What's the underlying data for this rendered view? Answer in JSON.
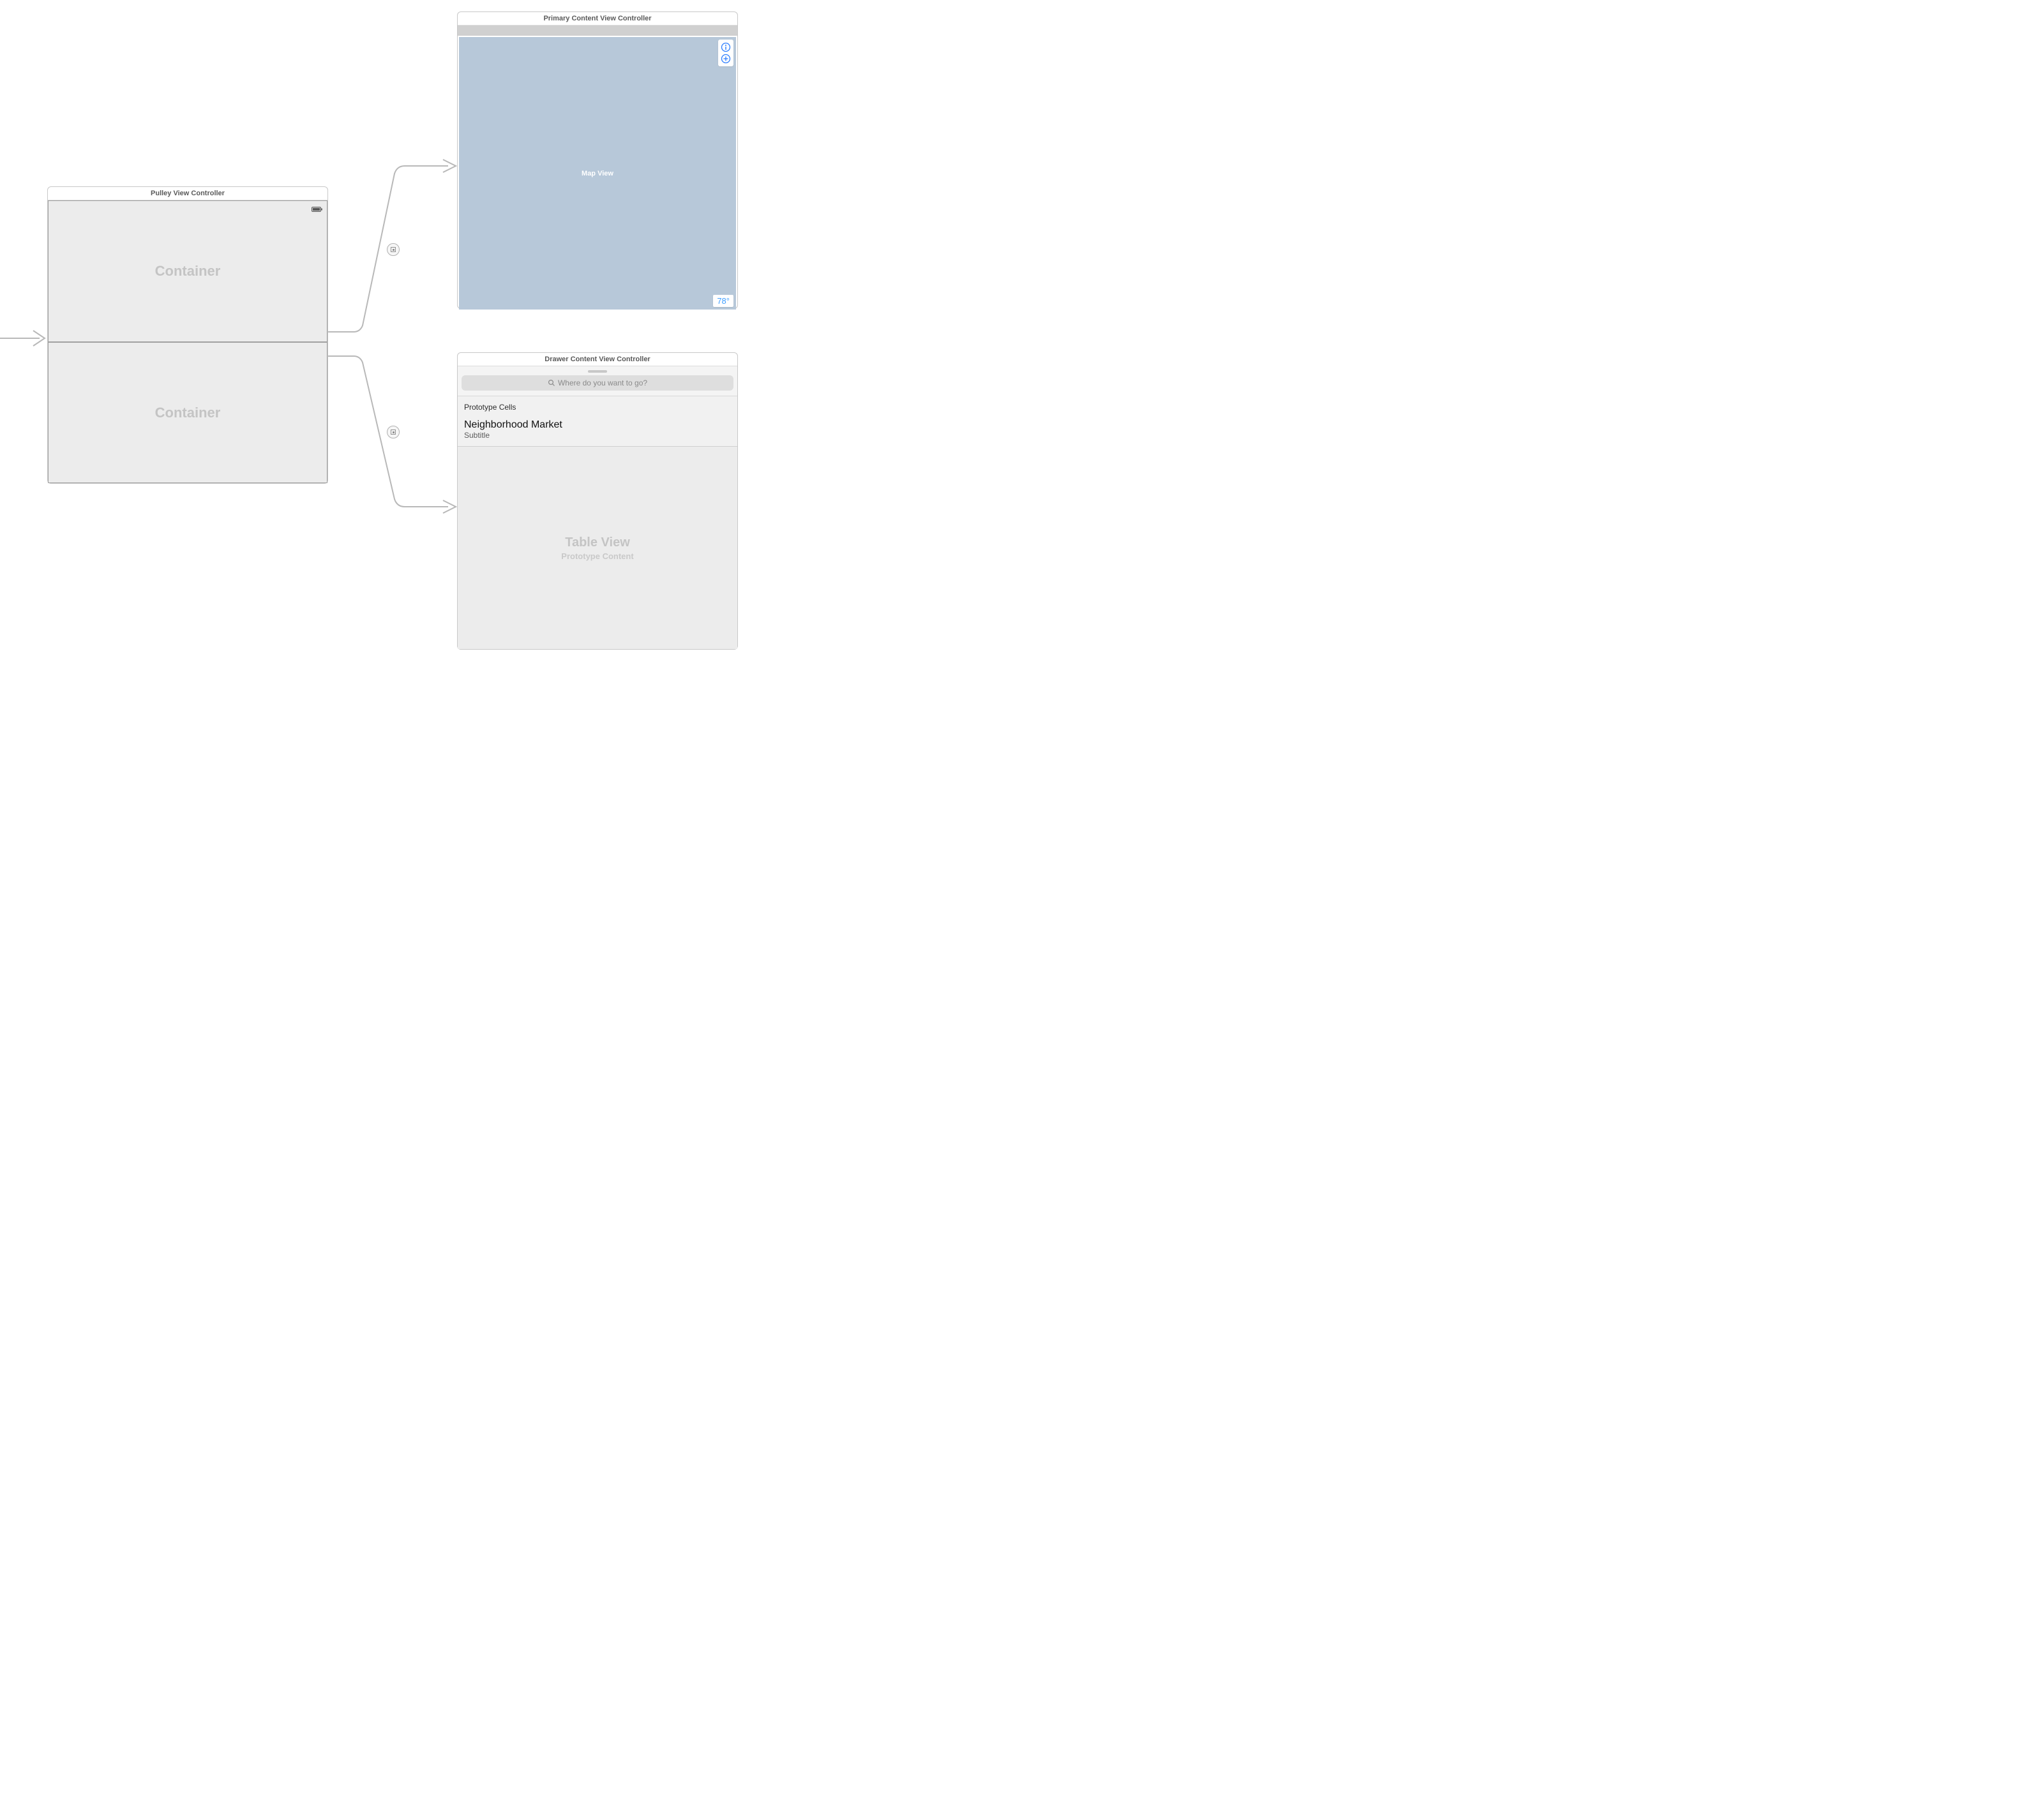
{
  "pulley": {
    "title": "Pulley View Controller",
    "container_top": "Container",
    "container_bottom": "Container"
  },
  "primary": {
    "title": "Primary Content View Controller",
    "map_label": "Map View",
    "temperature": "78°"
  },
  "drawer": {
    "title": "Drawer Content View Controller",
    "search_placeholder": "Where do you want to go?",
    "prototype_header": "Prototype Cells",
    "cell_title": "Neighborhood Market",
    "cell_subtitle": "Subtitle",
    "tableview_label": "Table View",
    "tableview_sub": "Prototype Content"
  }
}
